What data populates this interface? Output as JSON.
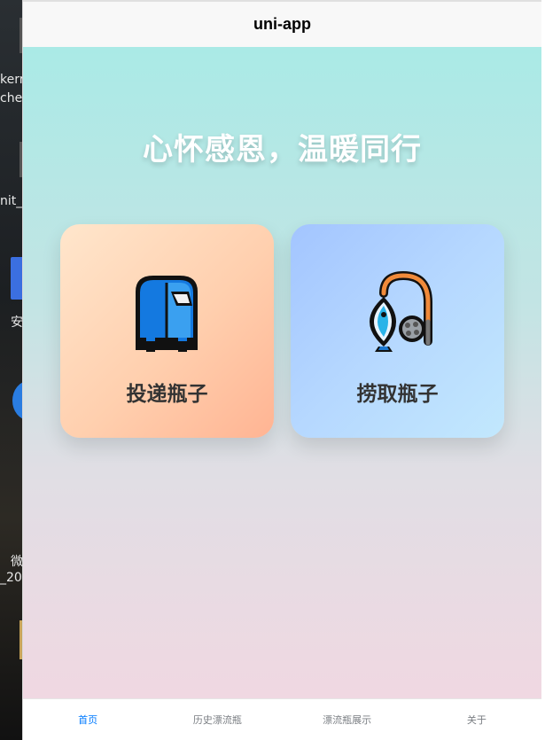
{
  "desktop": {
    "fragments": [
      "kerr",
      "chec",
      "nit_",
      "安",
      "微",
      "_20"
    ]
  },
  "window": {
    "title": "uni-app"
  },
  "home": {
    "headline": "心怀感恩，温暖同行",
    "cards": [
      {
        "label": "投递瓶子",
        "icon": "mailbox-icon"
      },
      {
        "label": "捞取瓶子",
        "icon": "fishing-icon"
      }
    ]
  },
  "tabbar": {
    "active_index": 0,
    "active_color": "#007aff",
    "tabs": [
      {
        "label": "首页"
      },
      {
        "label": "历史漂流瓶"
      },
      {
        "label": "漂流瓶展示"
      },
      {
        "label": "关于"
      }
    ]
  }
}
